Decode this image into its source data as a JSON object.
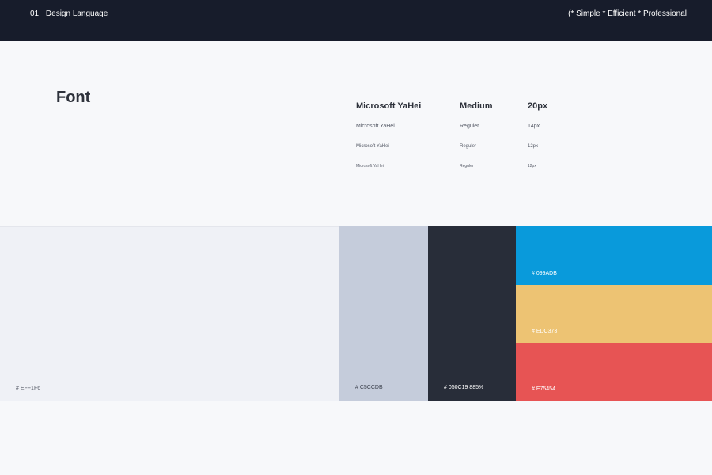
{
  "header": {
    "section_number": "01",
    "section_title": "Design Language",
    "tagline": "(* Simple * Efficient * Professional"
  },
  "font_section": {
    "title": "Font",
    "rows": [
      {
        "family": "Microsoft YaHei",
        "weight": "Medium",
        "size": "20px"
      },
      {
        "family": "Microsoft YaHei",
        "weight": "Reguler",
        "size": "14px"
      },
      {
        "family": "Microsoft YaHei",
        "weight": "Reguler",
        "size": "12px"
      },
      {
        "family": "Microsoft YaHei",
        "weight": "Reguler",
        "size": "12px"
      }
    ]
  },
  "colors": {
    "light": {
      "label": "# EFF1F6",
      "hex": "#EFF1F6"
    },
    "gray": {
      "label": "# C5CCDB",
      "hex": "#C5CCDB"
    },
    "dark": {
      "label": "# 050C19 885%",
      "hex": "#282D39"
    },
    "blue": {
      "label": "# 099ADB",
      "hex": "#099ADB"
    },
    "yellow": {
      "label": "# EDC373",
      "hex": "#EDC373"
    },
    "red": {
      "label": "# E75454",
      "hex": "#E75454"
    }
  }
}
